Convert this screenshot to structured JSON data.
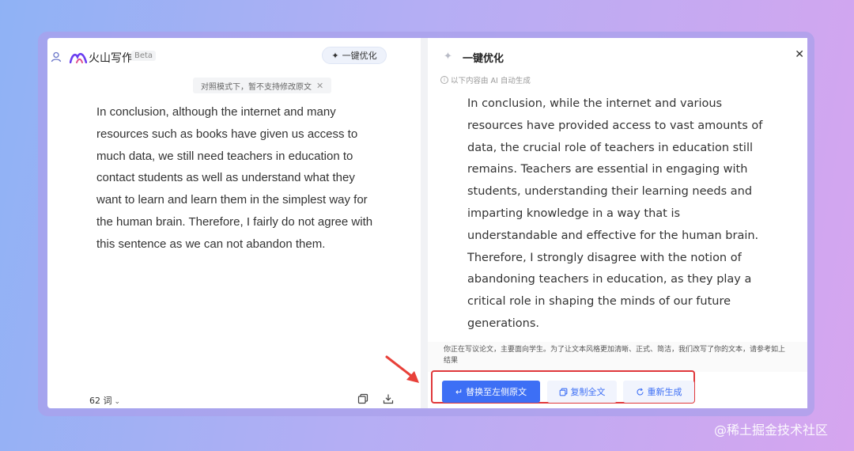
{
  "left": {
    "app_name": "火山写作",
    "beta": "Beta",
    "optimize_button": "一键优化",
    "notice": "对照模式下，暂不支持修改原文",
    "original_text": "In conclusion, although the internet and many resources such as books have given us access to much data, we still need teachers in education to contact students as well as understand what they want to learn and learn them in the simplest way for the human brain. Therefore, I fairly do not agree with this sentence as we can not abandon them.",
    "word_count": "62 词"
  },
  "right": {
    "title": "一键优化",
    "ai_note": "以下内容由 AI 自动生成",
    "result_text": "In conclusion, while the internet and various resources have provided access to vast amounts of data, the crucial role of teachers in education still remains. Teachers are essential in engaging with students, understanding their learning needs and imparting knowledge in a way that is understandable and effective for the human brain. Therefore, I strongly disagree with the notion of abandoning teachers in education, as they play a critical role in shaping the minds of our future generations.",
    "footnote": "你正在写议论文，主要面向学生。为了让文本风格更加清晰、正式、简洁，我们改写了你的文本，请参考如上结果",
    "replace_button": "替换至左侧原文",
    "copy_button": "复制全文",
    "regenerate_button": "重新生成"
  },
  "watermark": "@稀土掘金技术社区",
  "icons": {
    "user": "user-icon",
    "logo": "volcano-logo-icon",
    "sparkle": "sparkle-icon",
    "close": "close-icon",
    "info": "info-icon",
    "copy": "copy-icon",
    "download": "download-icon",
    "replace": "return-arrow-icon",
    "regenerate": "refresh-icon"
  },
  "colors": {
    "primary": "#3d6ff5",
    "highlight_border": "#e0383b",
    "arrow": "#e8413a"
  }
}
